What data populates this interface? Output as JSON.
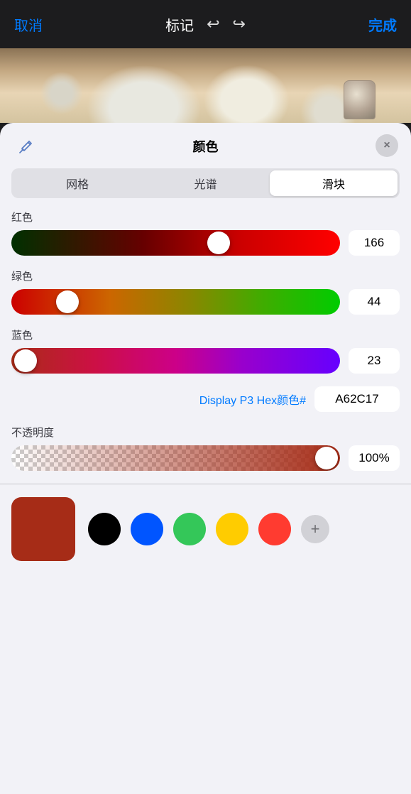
{
  "topBar": {
    "cancel": "取消",
    "title": "标记",
    "done": "完成",
    "undo_icon": "↩",
    "redo_icon": "↪"
  },
  "colorPanel": {
    "title": "颜色",
    "eyedropper_icon": "💉",
    "close_icon": "×",
    "tabs": [
      {
        "label": "网格",
        "active": false
      },
      {
        "label": "光谱",
        "active": false
      },
      {
        "label": "滑块",
        "active": true
      }
    ],
    "sliders": {
      "red": {
        "label": "红色",
        "value": "166",
        "thumb_position_pct": 63
      },
      "green": {
        "label": "绿色",
        "value": "44",
        "thumb_position_pct": 17
      },
      "blue": {
        "label": "蓝色",
        "value": "23",
        "thumb_position_pct": 8
      }
    },
    "hex": {
      "label": "Display P3 Hex颜色#",
      "value": "A62C17"
    },
    "opacity": {
      "label": "不透明度",
      "value": "100%",
      "thumb_position_pct": 96
    },
    "swatches": {
      "current_color": "#a62c17",
      "presets": [
        {
          "color": "#000000",
          "label": "black"
        },
        {
          "color": "#0055ff",
          "label": "blue"
        },
        {
          "color": "#34c759",
          "label": "green"
        },
        {
          "color": "#ffcc00",
          "label": "yellow"
        },
        {
          "color": "#ff3b30",
          "label": "red"
        }
      ]
    }
  }
}
